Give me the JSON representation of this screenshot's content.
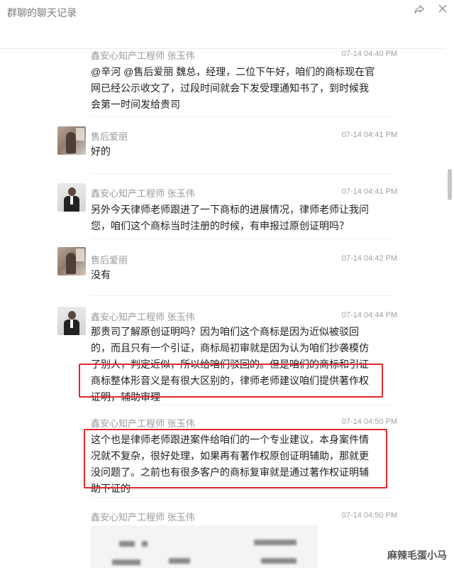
{
  "window": {
    "title": "群聊的聊天记录",
    "share_icon": "share-icon",
    "close_icon": "close-icon"
  },
  "messages": [
    {
      "sender": "鑫安心知产工程师 张玉伟",
      "time": "07-14 04:40 PM",
      "lines": [
        "@辛河 @售后爱丽 魏总，经理，二位下午好，咱们的商标现在官",
        "网已经公示收文了，过段时间就会下发受理通知书了，到时候我",
        "会第一时间发给贵司"
      ]
    },
    {
      "sender": "售后爱丽",
      "time": "07-14 04:41 PM",
      "lines": [
        "好的"
      ]
    },
    {
      "sender": "鑫安心知产工程师 张玉伟",
      "time": "07-14 04:41 PM",
      "lines": [
        "另外今天律师老师跟进了一下商标的进展情况，律师老师让我问",
        "您，咱们这个商标当时注册的时候，有申报过原创证明吗？"
      ]
    },
    {
      "sender": "售后爱丽",
      "time": "07-14 04:42 PM",
      "lines": [
        "没有"
      ]
    },
    {
      "sender": "鑫安心知产工程师 张玉伟",
      "time": "07-14 04:44 PM",
      "lines": [
        "那贵司了解原创证明吗？因为咱们这个商标是因为近似被驳回",
        "的，而且只有一个引证，商标局初审就是因为认为咱们抄袭模仿",
        "了别人，判定近似，所以给咱们驳回的。但是咱们的商标和引证",
        "商标整体形音义是有很大区别的，律师老师建议咱们提供著作权",
        "证明，辅助审理"
      ]
    },
    {
      "sender": "鑫安心知产工程师 张玉伟",
      "time": "07-14 04:50 PM",
      "lines": [
        "这个也是律师老师跟进案件给咱们的一个专业建议，本身案件情",
        "况就不复杂，很好处理，如果再有著作权原创证明辅助，那就更",
        "没问题了。之前也有很多客户的商标复审就是通过著作权证明辅",
        "助下证的"
      ]
    },
    {
      "sender": "鑫安心知产工程师 张玉伟",
      "time": "07-14 04:50 PM",
      "lines": []
    }
  ],
  "highlight_color": "#e2262c",
  "watermark": "麻辣毛蛋小马"
}
